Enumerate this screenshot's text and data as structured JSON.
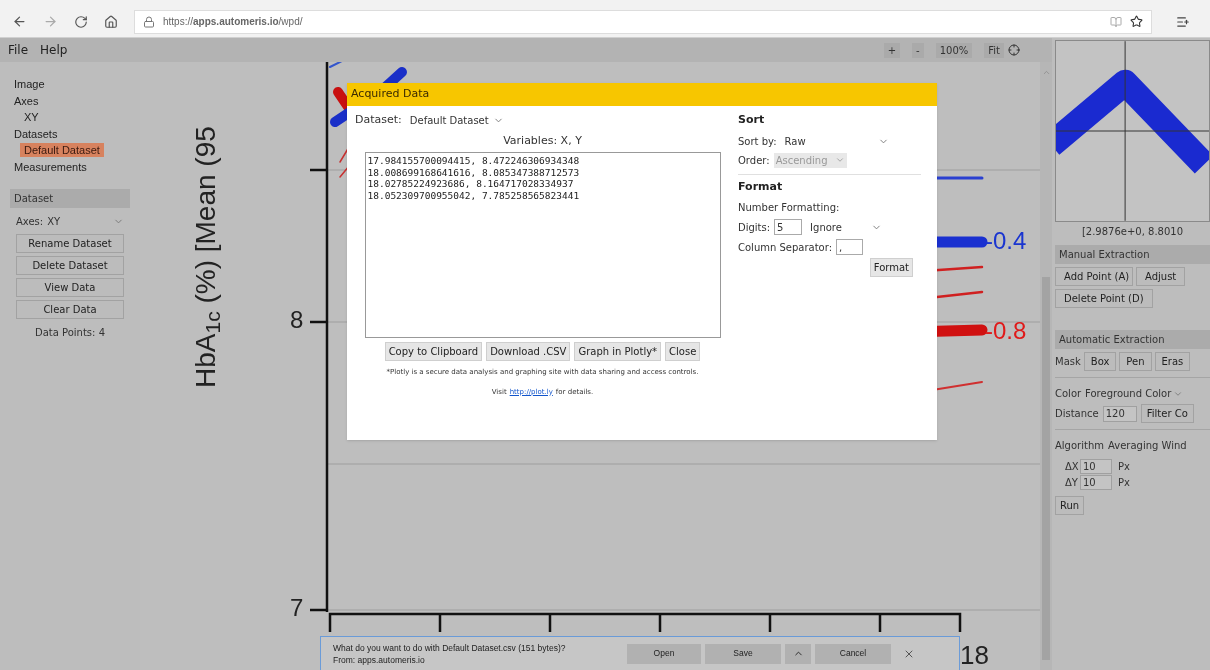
{
  "browser": {
    "url": "https://**apps.automeris.io**/wpd/"
  },
  "menu": [
    "File",
    "Help"
  ],
  "zoom_controls": [
    "+",
    "-",
    "100%",
    "Fit"
  ],
  "sidebar": {
    "items": [
      {
        "label": "Image",
        "selected": false
      },
      {
        "label": "Axes",
        "selected": false,
        "children": [
          {
            "label": "XY",
            "selected": false
          }
        ]
      },
      {
        "label": "Datasets",
        "selected": false,
        "children": [
          {
            "label": "Default Dataset",
            "selected": true
          }
        ]
      },
      {
        "label": "Measurements",
        "selected": false
      }
    ]
  },
  "dataset_panel": {
    "title": "Dataset",
    "axes_label": "Axes:",
    "axes_value": "XY",
    "buttons": [
      "Rename Dataset",
      "Delete Dataset",
      "View Data",
      "Clear Data"
    ],
    "data_points": "Data Points: 4"
  },
  "plot_image": {
    "y_title": "HbA$_{1c}$ (%)  [Mean (95",
    "y_ticks": [
      "8",
      "7"
    ],
    "x_tick": "18",
    "series_labels": [
      {
        "text": "-0.4",
        "color": "#1a35d0"
      },
      {
        "text": "-0.8",
        "color": "#e01a1a"
      }
    ]
  },
  "dialog": {
    "title": "Acquired Data",
    "dataset_label": "Dataset:",
    "dataset_value": "Default Dataset",
    "variables": "Variables: X, Y",
    "data_lines": [
      "17.984155700094415, 8.472246306934348",
      "18.008699168641616, 8.085347388712573",
      "18.02785224923686, 8.164717028334937",
      "18.052309700955042, 7.785258565823441"
    ],
    "buttons": [
      "Copy to Clipboard",
      "Download .CSV",
      "Graph in Plotly*",
      "Close"
    ],
    "note": "*Plotly is a secure data analysis and graphing site with data sharing and access controls.",
    "visit": {
      "before": "Visit",
      "link": "http://plot.ly",
      "after": "for details."
    },
    "sort": {
      "heading": "Sort",
      "sort_by_label": "Sort by:",
      "sort_by_value": "Raw",
      "order_label": "Order:",
      "order_value": "Ascending",
      "order_disabled": true
    },
    "format": {
      "heading": "Format",
      "number_formatting": "Number Formatting:",
      "digits_label": "Digits:",
      "digits_value": "5",
      "digits_mode": "Ignore",
      "separator_label": "Column Separator:",
      "separator_value": ",",
      "button": "Format"
    }
  },
  "right_panel": {
    "coordinates": "[2.9876e+0, 8.8010",
    "manual_title": "Manual Extraction",
    "manual_buttons": [
      "Add Point (A)",
      "Adjust",
      "Delete Point (D)"
    ],
    "auto_title": "Automatic Extraction",
    "mask_label": "Mask",
    "mask_buttons": [
      "Box",
      "Pen",
      "Eras"
    ],
    "color_label": "Color",
    "color_value": "Foreground Color",
    "distance_label": "Distance",
    "distance_value": "120",
    "filter_button": "Filter Co",
    "algorithm_label": "Algorithm",
    "algorithm_value": "Averaging Wind",
    "params": [
      {
        "label": "ΔX",
        "value": "10",
        "unit": "Px"
      },
      {
        "label": "ΔY",
        "value": "10",
        "unit": "Px"
      }
    ],
    "run": "Run"
  },
  "download_bar": {
    "message": "What do you want to do with Default Dataset.csv (151 bytes)?",
    "source": "From: apps.automeris.io",
    "buttons": [
      "Open",
      "Save",
      "Cancel"
    ]
  }
}
